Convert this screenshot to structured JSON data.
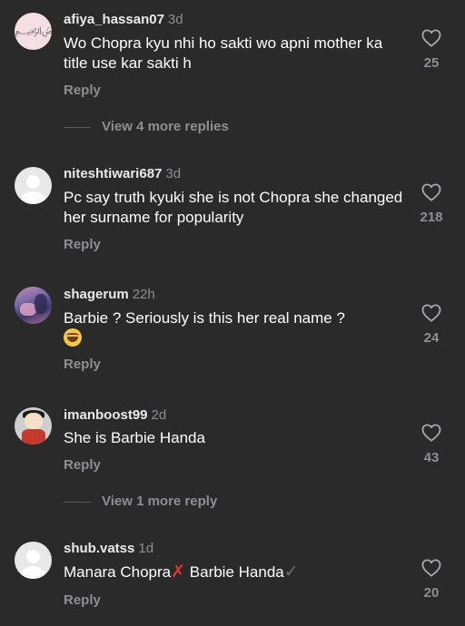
{
  "comments": [
    {
      "username": "afiya_hassan07",
      "time": "3d",
      "text": "Wo Chopra kyu nhi ho sakti wo apni mother ka title use kar sakti h",
      "reply_label": "Reply",
      "likes": "25",
      "more_replies": "View 4 more replies",
      "avatar": "pink-avatar"
    },
    {
      "username": "niteshtiwari687",
      "time": "3d",
      "text": "Pc say truth kyuki she is not Chopra she changed her surname for popularity",
      "reply_label": "Reply",
      "likes": "218",
      "avatar": "default-avatar"
    },
    {
      "username": "shagerum",
      "time": "22h",
      "text": "Barbie ? Seriously  is this her real name ?",
      "reply_label": "Reply",
      "likes": "24",
      "avatar": "photo-avatar"
    },
    {
      "username": "imanboost99",
      "time": "2d",
      "text": "She is Barbie Handa",
      "reply_label": "Reply",
      "likes": "43",
      "more_replies": "View 1 more reply",
      "avatar": "cartoon-avatar"
    },
    {
      "username": "shub.vatss",
      "time": "1d",
      "text_part1": "Manara Chopra",
      "text_part2": " Barbie Handa",
      "reply_label": "Reply",
      "likes": "20",
      "avatar": "default-avatar"
    }
  ],
  "icons": {
    "like": "heart-outline-icon",
    "laugh": "laughing-emoji",
    "cross": "red-cross-emoji",
    "check": "check-mark-emoji"
  },
  "colors": {
    "background": "#2a2a2b",
    "secondary_text": "#8e8e93",
    "primary_text": "#ffffff"
  }
}
